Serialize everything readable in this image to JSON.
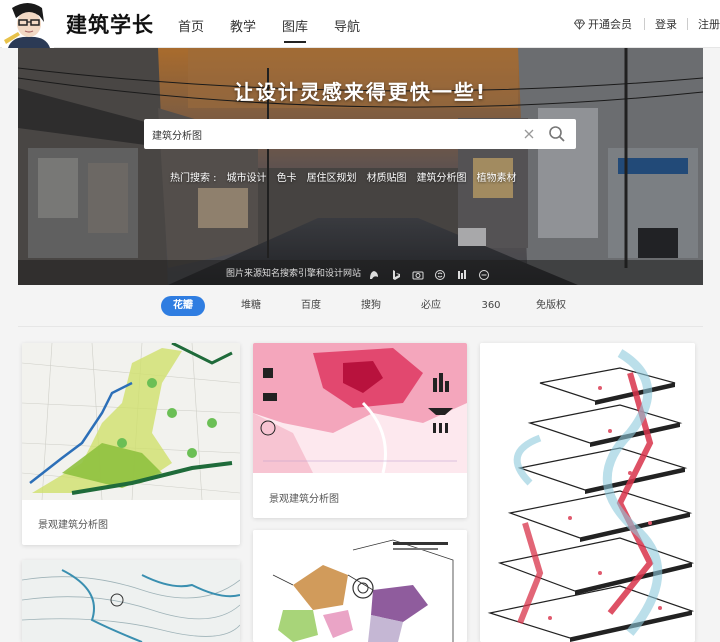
{
  "header": {
    "logo_text": "建筑学长",
    "nav": [
      {
        "label": "首页",
        "active": false
      },
      {
        "label": "教学",
        "active": false
      },
      {
        "label": "图库",
        "active": true
      },
      {
        "label": "导航",
        "active": false
      }
    ],
    "vip_label": "开通会员",
    "login_label": "登录",
    "register_label": "注册"
  },
  "banner": {
    "title": "让设计灵感来得更快一些!",
    "search": {
      "value": "建筑分析图",
      "placeholder": "建筑分析图"
    },
    "hot_label": "热门搜索 :",
    "hot_items": [
      "城市设计",
      "色卡",
      "居住区规划",
      "材质贴图",
      "建筑分析图",
      "植物素材"
    ],
    "footer_text": "图片来源知名搜索引擎和设计网站"
  },
  "source_tabs": [
    {
      "label": "花瓣",
      "active": true
    },
    {
      "label": "堆糖",
      "active": false
    },
    {
      "label": "百度",
      "active": false
    },
    {
      "label": "搜狗",
      "active": false
    },
    {
      "label": "必应",
      "active": false
    },
    {
      "label": "360",
      "active": false
    },
    {
      "label": "免版权",
      "active": false
    }
  ],
  "cards": [
    {
      "caption": "景观建筑分析图"
    },
    {
      "caption": "景观建筑分析图"
    }
  ],
  "colors": {
    "accent": "#2f7de1",
    "header_bg": "#ffffff",
    "page_bg": "#f4f4f4"
  }
}
